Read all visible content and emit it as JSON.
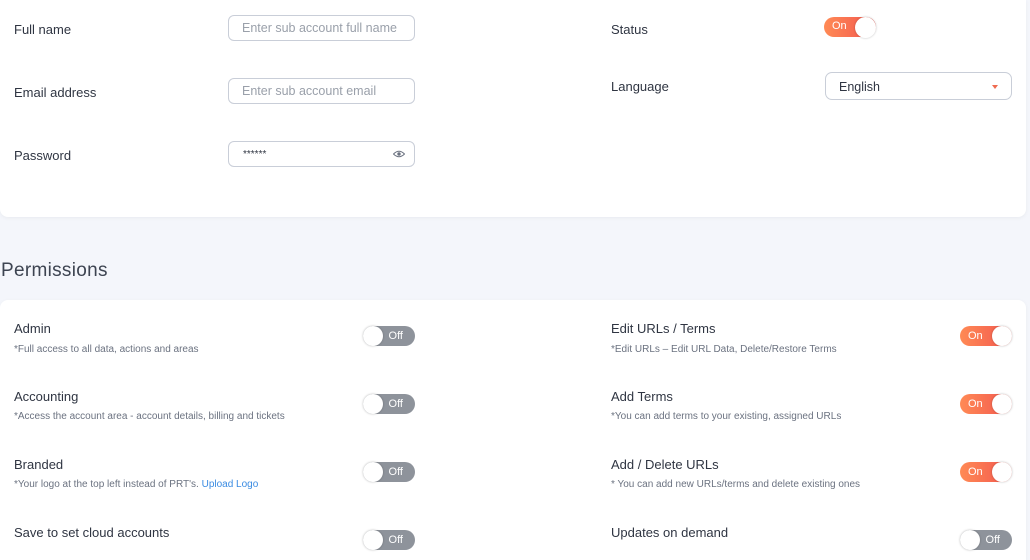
{
  "account_form": {
    "full_name": {
      "label": "Full name",
      "placeholder": "Enter sub account full name",
      "value": ""
    },
    "email": {
      "label": "Email address",
      "placeholder": "Enter sub account email",
      "value": ""
    },
    "password": {
      "label": "Password",
      "value": "******"
    },
    "status": {
      "label": "Status",
      "toggle_text": "On",
      "state": "on"
    },
    "language": {
      "label": "Language",
      "selected": "English"
    }
  },
  "permissions": {
    "title": "Permissions",
    "items": [
      {
        "label": "Admin",
        "desc": "*Full access to all data, actions and areas",
        "state": "Off"
      },
      {
        "label": "Edit URLs / Terms",
        "desc": "*Edit URLs – Edit URL Data, Delete/Restore Terms",
        "state": "On"
      },
      {
        "label": "Accounting",
        "desc": "*Access the account area - account details, billing and tickets",
        "state": "Off"
      },
      {
        "label": "Add Terms",
        "desc": "*You can add terms to your existing, assigned URLs",
        "state": "On"
      },
      {
        "label": "Branded",
        "desc": "*Your logo at the top left instead of PRT's.",
        "link": "Upload Logo",
        "state": "Off"
      },
      {
        "label": "Add / Delete URLs",
        "desc": "* You can add new URLs/terms and delete existing ones",
        "state": "On"
      },
      {
        "label": "Save to set cloud accounts",
        "desc": "",
        "state": "Off"
      },
      {
        "label": "Updates on demand",
        "desc": "",
        "state": "Off"
      }
    ]
  },
  "colors": {
    "toggle_on": "#f2564f",
    "toggle_off": "#8e939b",
    "link": "#3a8be2",
    "background": "#f4f6fb"
  }
}
